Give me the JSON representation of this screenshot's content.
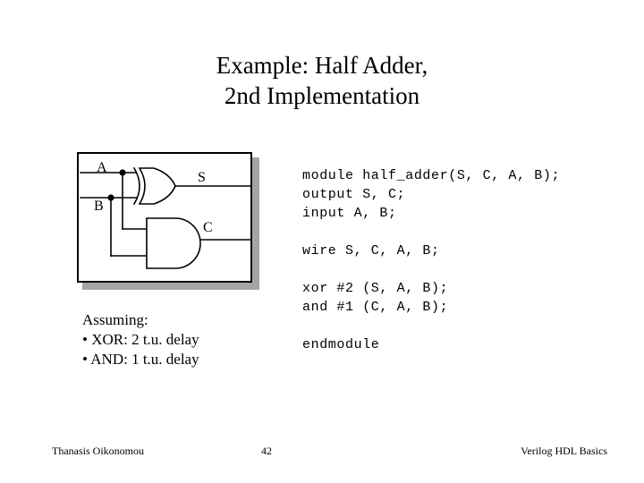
{
  "slide": {
    "title": "Example: Half Adder,\n2nd Implementation",
    "background_color": "#ffffff",
    "text_color": "#000000"
  },
  "circuit": {
    "shadow_color": "#a5a5a5",
    "border_color": "#000000",
    "inputs": [
      {
        "name": "A",
        "label": "A"
      },
      {
        "name": "B",
        "label": "B"
      }
    ],
    "outputs": [
      {
        "name": "S",
        "label": "S"
      },
      {
        "name": "C",
        "label": "C"
      }
    ],
    "gates": [
      {
        "type": "xor",
        "output": "S"
      },
      {
        "type": "and",
        "output": "C"
      }
    ]
  },
  "assuming": {
    "heading": "Assuming:",
    "items": [
      "• XOR: 2 t.u. delay",
      "• AND: 1 t.u. delay"
    ]
  },
  "code": {
    "block1": "module half_adder(S, C, A, B);\noutput S, C;\ninput A, B;",
    "block2": "wire S, C, A, B;",
    "block3": "xor #2 (S, A, B);\nand #1 (C, A, B);",
    "block4": "endmodule"
  },
  "footer": {
    "author": "Thanasis Oikonomou",
    "page_number": "42",
    "course": "Verilog HDL Basics"
  }
}
